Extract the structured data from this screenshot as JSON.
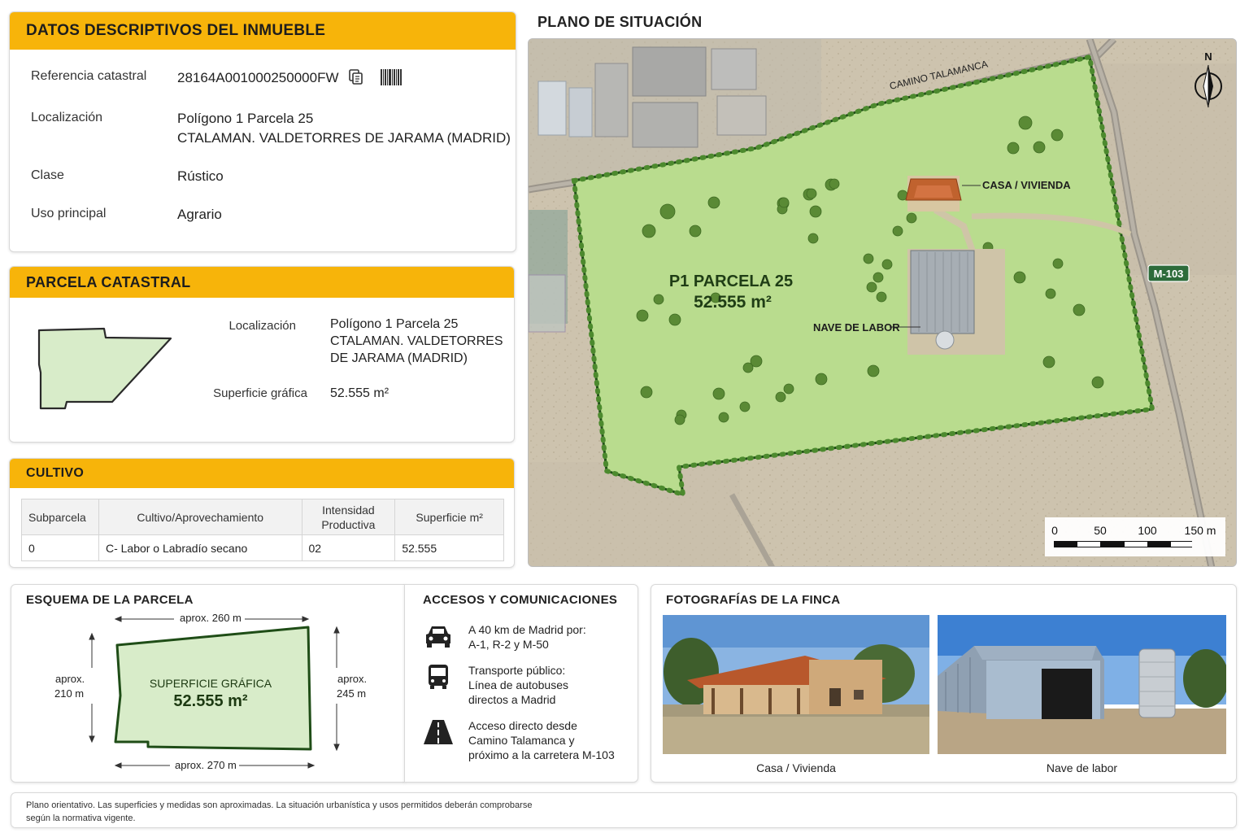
{
  "datos": {
    "title": "DATOS DESCRIPTIVOS DEL INMUEBLE",
    "ref_label": "Referencia catastral",
    "ref_value": "28164A001000250000FW",
    "loc_label": "Localización",
    "loc_line1": "Polígono 1 Parcela 25",
    "loc_line2": "CTALAMAN. VALDETORRES DE JARAMA (MADRID)",
    "clase_label": "Clase",
    "clase_value": "Rústico",
    "uso_label": "Uso principal",
    "uso_value": "Agrario"
  },
  "parcela": {
    "title": "PARCELA CATASTRAL",
    "loc_label": "Localización",
    "loc_line1": "Polígono 1 Parcela 25",
    "loc_line2": "CTALAMAN. VALDETORRES",
    "loc_line3": "DE JARAMA (MADRID)",
    "sup_label": "Superficie gráfica",
    "sup_value": "52.555 m²"
  },
  "cultivo": {
    "title": "CULTIVO",
    "headers": [
      "Subparcela",
      "Cultivo/Aprovechamiento",
      "Intensidad Productiva",
      "Superficie m²"
    ],
    "rows": [
      [
        "0",
        "C- Labor o Labradío secano",
        "02",
        "52.555"
      ]
    ]
  },
  "plano": {
    "title": "PLANO DE  SITUACIÓN",
    "road_label": "CAMINO TALAMANCA",
    "north": "N",
    "highway": "M-103",
    "parcel_name": "P1 PARCELA 25",
    "parcel_area": "52.555 m²",
    "casa_label": "CASA / VIVIENDA",
    "nave_label": "NAVE DE LABOR",
    "scale_ticks": [
      "0",
      "50",
      "100",
      "150 m"
    ]
  },
  "esquema": {
    "title": "ESQUEMA DE LA PARCELA",
    "top": "aprox. 260 m",
    "bottom": "aprox. 270 m",
    "left_l1": "aprox.",
    "left_l2": "210 m",
    "right_l1": "aprox.",
    "right_l2": "245 m",
    "center_label": "SUPERFICIE GRÁFICA",
    "center_value": "52.555 m²"
  },
  "accesos": {
    "title": "ACCESOS Y COMUNICACIONES",
    "car_l1": "A 40 km de Madrid por:",
    "car_l2": "A-1, R-2 y M-50",
    "bus_l1": "Transporte público:",
    "bus_l2": "Línea de autobuses",
    "bus_l3": "directos a Madrid",
    "road_l1": "Acceso directo desde",
    "road_l2": "Camino Talamanca y",
    "road_l3": "próximo a la carretera M-103"
  },
  "fotos": {
    "title": "FOTOGRAFÍAS DE LA FINCA",
    "cap1": "Casa / Vivienda",
    "cap2": "Nave de labor"
  },
  "nota": {
    "line1": "Plano orientativo. Las superficies y medidas son aproximadas. La situación urbanística y usos permitidos deberán comprobarse",
    "line2": "según la normativa vigente."
  },
  "colors": {
    "accent": "#f7b40a",
    "parcel_fill": "#b9dc8e",
    "parcel_border": "#1f4d17"
  }
}
